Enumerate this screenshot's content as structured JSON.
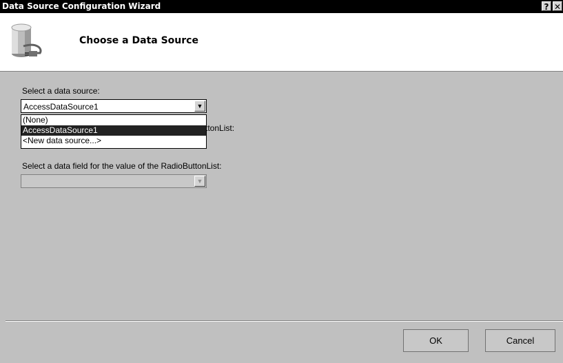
{
  "window": {
    "title": "Data Source Configuration Wizard",
    "help_label": "?",
    "close_label": "✕"
  },
  "header": {
    "title": "Choose a Data Source",
    "icon": "database-plug-icon"
  },
  "form": {
    "data_source_label": "Select a data source:",
    "data_source_value": "AccessDataSource1",
    "dropdown_options": [
      "(None)",
      "AccessDataSource1",
      "<New data source...>"
    ],
    "dropdown_selected": "AccessDataSource1",
    "display_field_label_visible_tail": "ttonList:",
    "value_field_label": "Select a data field for the value of the RadioButtonList:",
    "value_field_value": ""
  },
  "footer": {
    "ok_label": "OK",
    "cancel_label": "Cancel"
  }
}
